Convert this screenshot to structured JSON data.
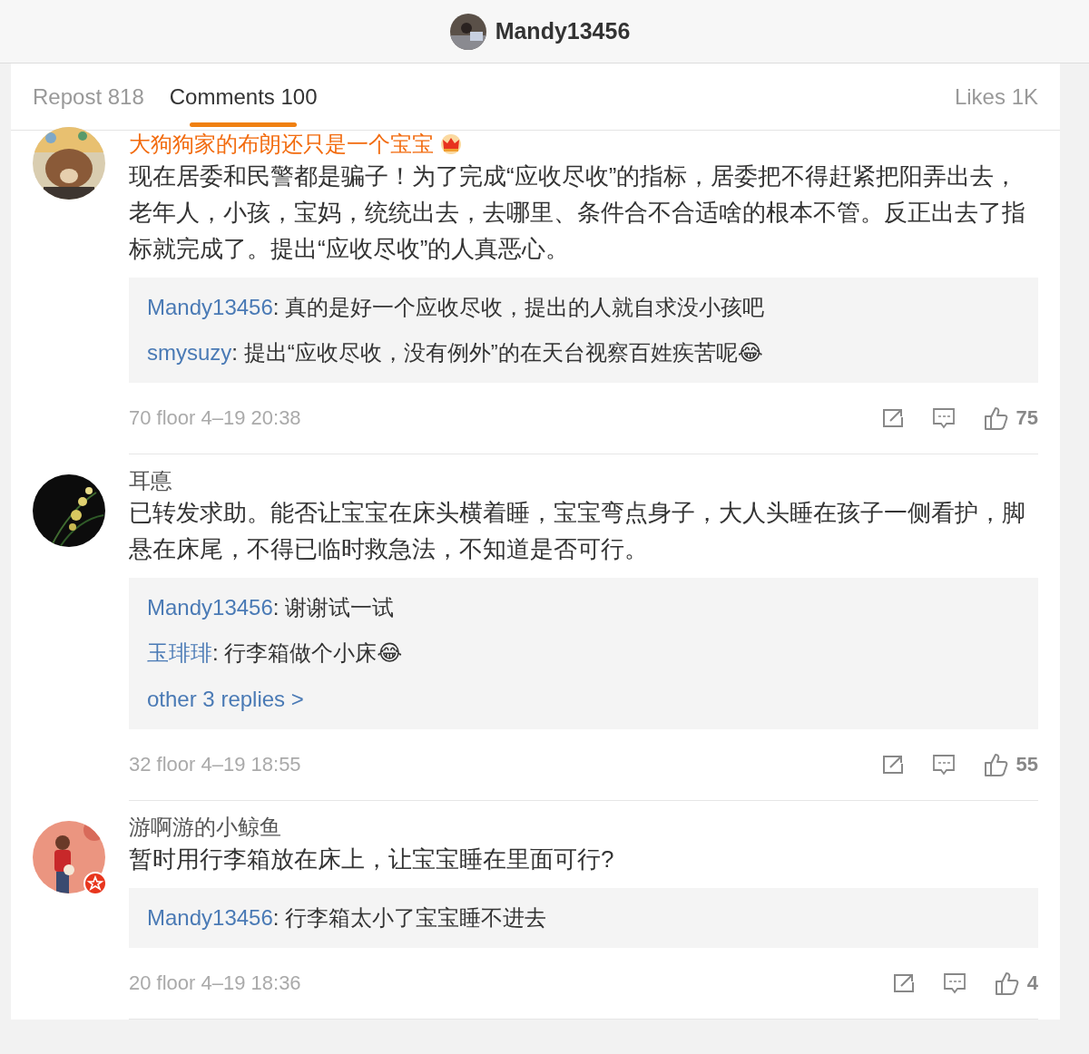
{
  "header": {
    "username": "Mandy13456"
  },
  "tabs": [
    {
      "label": "Repost 818",
      "selected": false
    },
    {
      "label": "Comments 100",
      "selected": true
    },
    {
      "label": "Likes 1K",
      "selected": false
    }
  ],
  "comments": [
    {
      "author": "大狗狗家的布朗还只是一个宝宝",
      "vip": true,
      "verified": false,
      "text": "现在居委和民警都是骗子！为了完成“应收尽收”的指标，居委把不得赶紧把阳弄出去，老年人，小孩，宝妈，统统出去，去哪里、条件合不合适啥的根本不管。反正出去了指标就完成了。提出“应收尽收”的人真恶心。",
      "replies": [
        {
          "name": "Mandy13456",
          "text": ": 真的是好一个应收尽收，提出的人就自求没小孩吧"
        },
        {
          "name": "smysuzy",
          "text": ": 提出“应收尽收，没有例外”的在天台视察百姓疾苦呢😂"
        }
      ],
      "meta": "70 floor 4–19 20:38",
      "likes": "75"
    },
    {
      "author": "耳悳",
      "vip": false,
      "verified": false,
      "text": "已转发求助。能否让宝宝在床头横着睡，宝宝弯点身子，大人头睡在孩子一侧看护，脚悬在床尾，不得已临时救急法，不知道是否可行。",
      "replies": [
        {
          "name": "Mandy13456",
          "text": ": 谢谢试一试"
        },
        {
          "name": "玉琲琲",
          "text": ": 行李箱做个小床😂"
        }
      ],
      "more": "other 3 replies >",
      "meta": "32 floor 4–19 18:55",
      "likes": "55"
    },
    {
      "author": "游啊游的小鲸鱼",
      "vip": false,
      "verified": true,
      "text": "暂时用行李箱放在床上，让宝宝睡在里面可行?",
      "replies": [
        {
          "name": "Mandy13456",
          "text": ": 行李箱太小了宝宝睡不进去"
        }
      ],
      "meta": "20 floor 4–19 18:36",
      "likes": "4"
    }
  ]
}
